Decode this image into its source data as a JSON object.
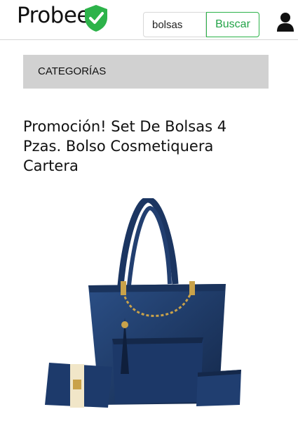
{
  "header": {
    "brand": "Probee",
    "brand_color": "#2db34a",
    "search": {
      "value": "bolsas",
      "button_label": "Buscar"
    },
    "icons": [
      "shield-check-icon",
      "user-icon"
    ]
  },
  "categories": {
    "label": "CATEGORÍAS"
  },
  "product": {
    "title": "Promoción! Set De Bolsas 4 Pzas. Bolso Cosmetiquera Cartera",
    "image": "navy-handbag-set"
  }
}
